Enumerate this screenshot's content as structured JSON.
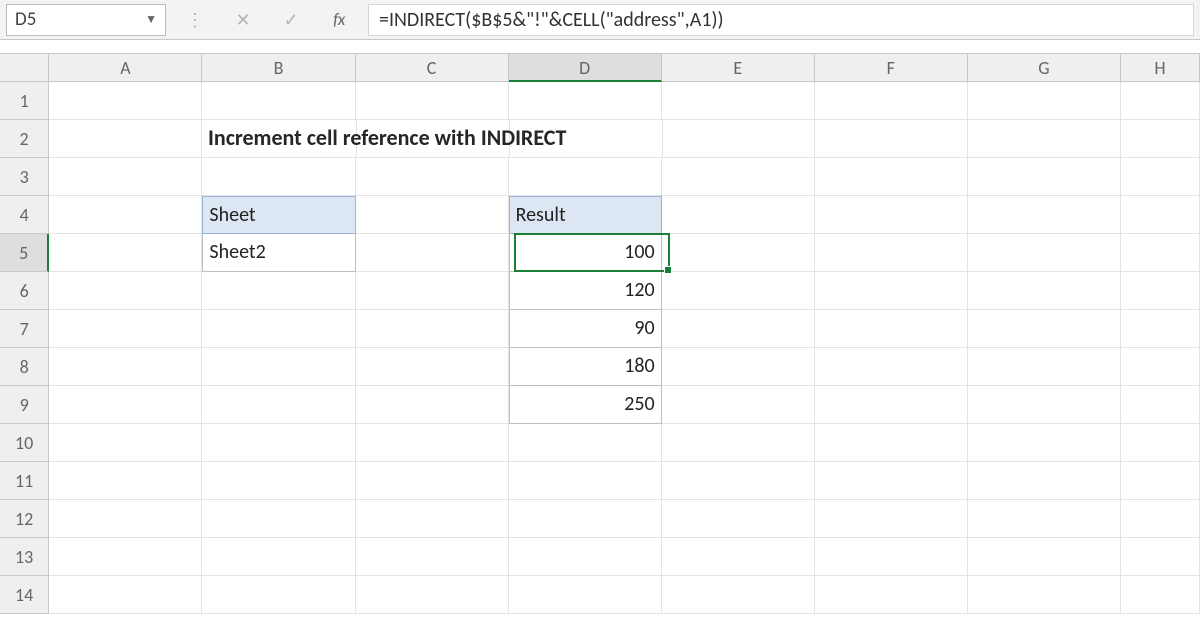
{
  "namebox": {
    "value": "D5"
  },
  "formula_bar": {
    "fx_label": "fx",
    "cancel_icon": "✕",
    "enter_icon": "✓",
    "formula": "=INDIRECT($B$5&\"!\"&CELL(\"address\",A1))"
  },
  "columns": [
    "A",
    "B",
    "C",
    "D",
    "E",
    "F",
    "G",
    "H"
  ],
  "rows": [
    "1",
    "2",
    "3",
    "4",
    "5",
    "6",
    "7",
    "8",
    "9",
    "10",
    "11",
    "12",
    "13",
    "14"
  ],
  "title": "Increment cell reference with INDIRECT",
  "sheet_table": {
    "header": "Sheet",
    "value": "Sheet2"
  },
  "result_table": {
    "header": "Result",
    "values": [
      "100",
      "120",
      "90",
      "180",
      "250"
    ]
  },
  "active_cell": "D5",
  "active_col": "D",
  "active_row": "5"
}
